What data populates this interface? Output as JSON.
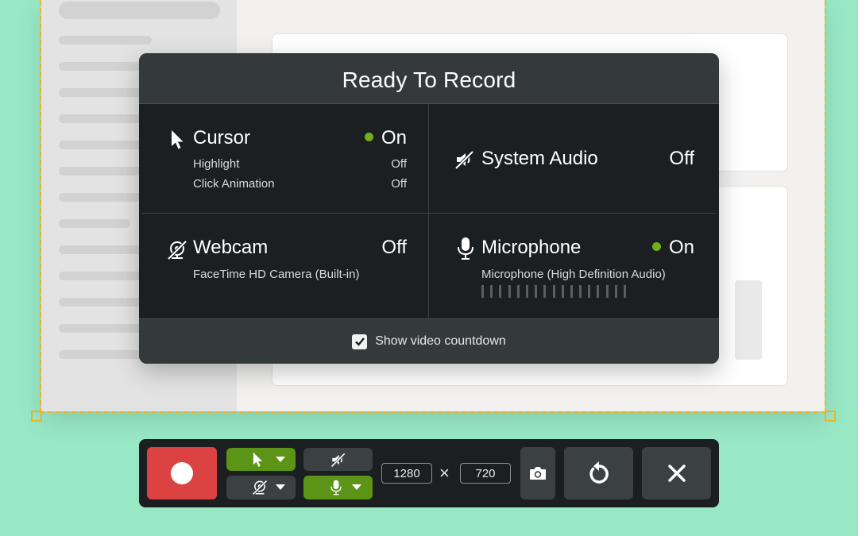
{
  "panel": {
    "title": "Ready To Record",
    "cursor": {
      "label": "Cursor",
      "status": "On",
      "options": [
        {
          "label": "Highlight",
          "value": "Off"
        },
        {
          "label": "Click Animation",
          "value": "Off"
        }
      ]
    },
    "system_audio": {
      "label": "System Audio",
      "status": "Off"
    },
    "webcam": {
      "label": "Webcam",
      "status": "Off",
      "device": "FaceTime HD Camera (Built-in)"
    },
    "microphone": {
      "label": "Microphone",
      "status": "On",
      "device": "Microphone (High Definition Audio)",
      "level_bars": 17,
      "level": 0
    },
    "footer": {
      "countdown_label": "Show video countdown",
      "countdown_checked": true
    }
  },
  "toolbar": {
    "width": "1280",
    "height": "720",
    "times_symbol": "×"
  },
  "colors": {
    "background": "#98e8c6",
    "panel": "#1c1f21",
    "panel_header": "#343a3b",
    "on_indicator": "#6fae1c",
    "record": "#dc4242",
    "toggle_on": "#5b9416",
    "selection": "#f2b21e"
  },
  "icons": [
    "cursor-icon",
    "audio-muted-icon",
    "webcam-off-icon",
    "microphone-icon",
    "checkmark-icon",
    "camera-icon",
    "restart-icon",
    "close-icon",
    "chevron-down-icon"
  ]
}
